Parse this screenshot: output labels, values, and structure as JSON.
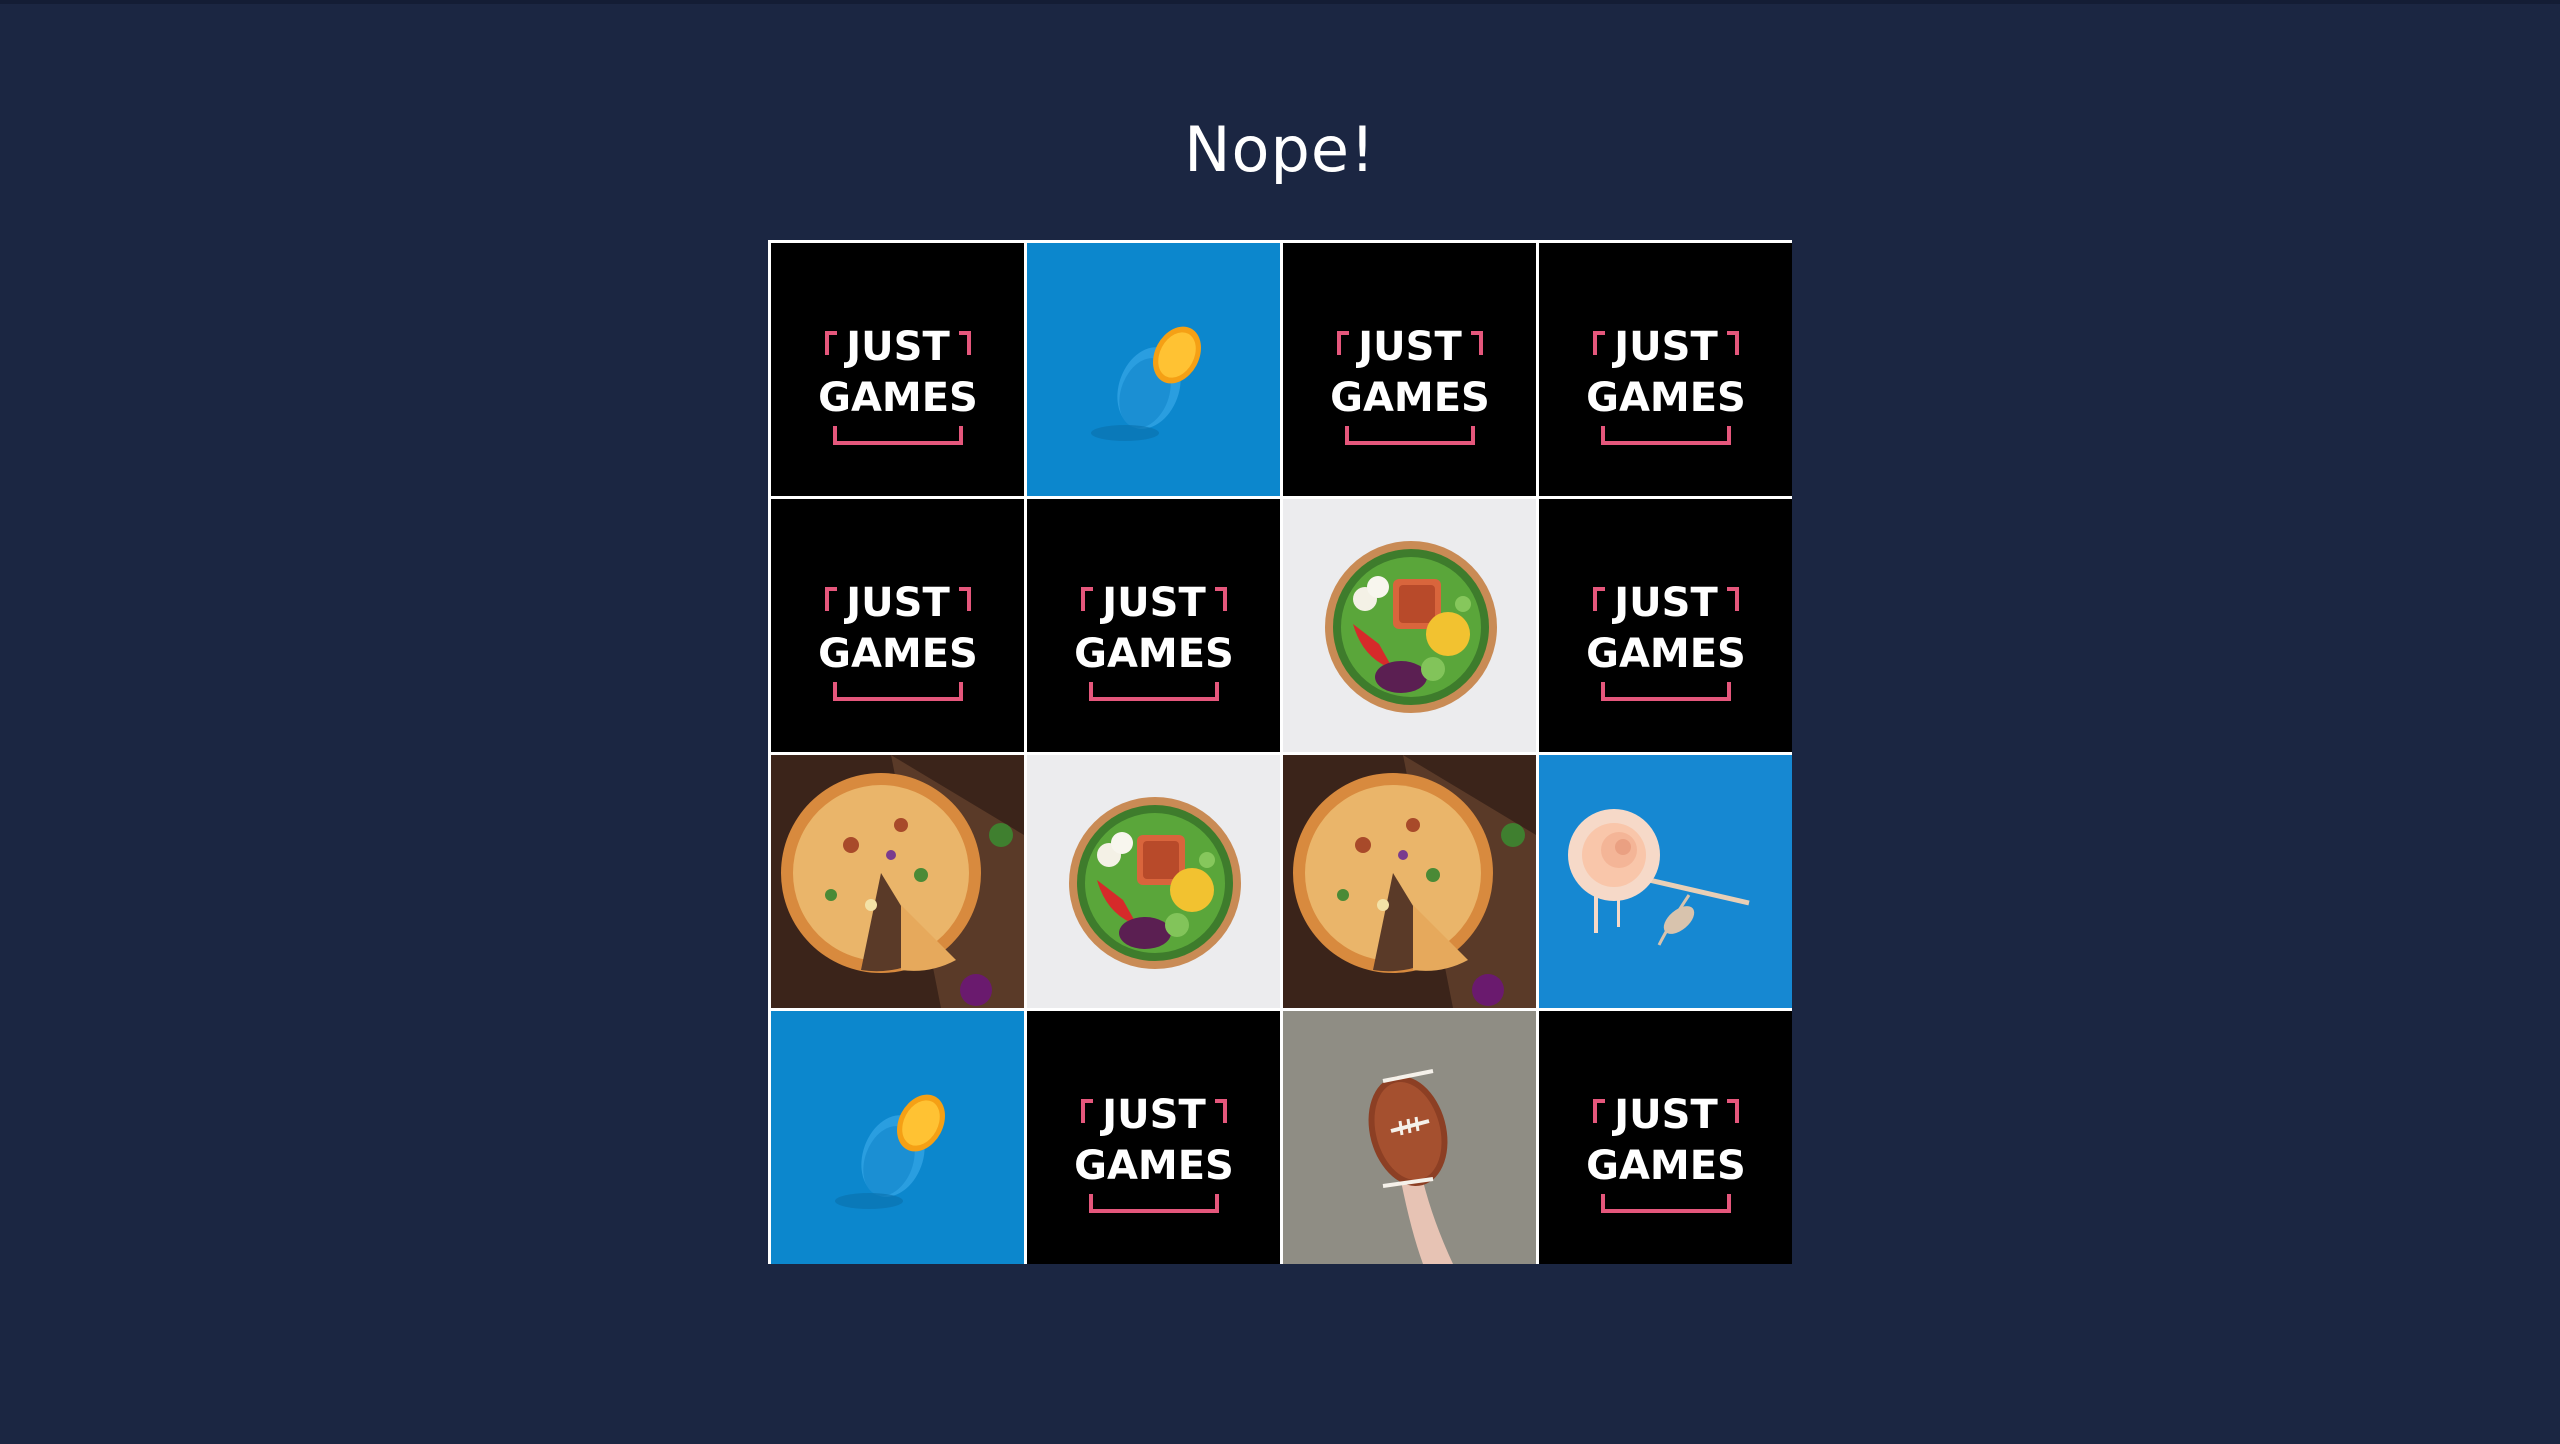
{
  "game": {
    "status_message": "Nope!",
    "brand_line_1": "JUST",
    "brand_line_2": "GAMES",
    "colors": {
      "background": "#1b2642",
      "card_back": "#000000",
      "brand_bracket": "#e5577c",
      "grid_border": "#ffffff"
    }
  },
  "board": {
    "rows": 4,
    "columns": 4,
    "cards": [
      {
        "state": "hidden",
        "face": "card-back"
      },
      {
        "state": "revealed",
        "face": "orange-icon"
      },
      {
        "state": "hidden",
        "face": "card-back"
      },
      {
        "state": "hidden",
        "face": "card-back"
      },
      {
        "state": "hidden",
        "face": "card-back"
      },
      {
        "state": "hidden",
        "face": "card-back"
      },
      {
        "state": "revealed",
        "face": "salad-bowl-icon"
      },
      {
        "state": "hidden",
        "face": "card-back"
      },
      {
        "state": "revealed",
        "face": "pizza-icon"
      },
      {
        "state": "revealed",
        "face": "salad-bowl-icon"
      },
      {
        "state": "revealed",
        "face": "pizza-icon"
      },
      {
        "state": "revealed",
        "face": "rose-icon"
      },
      {
        "state": "revealed",
        "face": "orange-icon"
      },
      {
        "state": "hidden",
        "face": "card-back"
      },
      {
        "state": "revealed",
        "face": "football-icon"
      },
      {
        "state": "hidden",
        "face": "card-back"
      }
    ]
  }
}
